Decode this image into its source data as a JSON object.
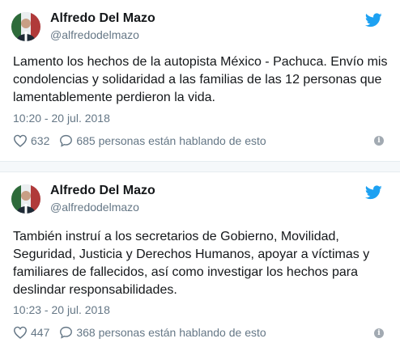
{
  "tweets": [
    {
      "author_name": "Alfredo Del Mazo",
      "author_handle": "@alfredodelmazo",
      "text": "Lamento los hechos de la autopista México - Pachuca. Envío mis condolencias y solidaridad a las familias de las 12 personas que lamentablemente perdieron la vida.",
      "timestamp": "10:20 - 20 jul. 2018",
      "likes": "632",
      "talking": "685 personas están hablando de esto"
    },
    {
      "author_name": "Alfredo Del Mazo",
      "author_handle": "@alfredodelmazo",
      "text": "También instruí a los secretarios de Gobierno, Movilidad, Seguridad, Justicia y Derechos Humanos, apoyar a víctimas y familiares de fallecidos, así como investigar los hechos para deslindar responsabilidades.",
      "timestamp": "10:23 - 20 jul. 2018",
      "likes": "447",
      "talking": "368 personas están hablando de esto"
    }
  ],
  "icons": {
    "brand": "twitter-bird-icon",
    "like": "heart-icon",
    "talk": "comment-bubble-icon",
    "info": "info-icon"
  },
  "colors": {
    "twitter_blue": "#1da1f2",
    "text": "#14171a",
    "muted": "#657786",
    "separator": "#f5f8fa"
  }
}
